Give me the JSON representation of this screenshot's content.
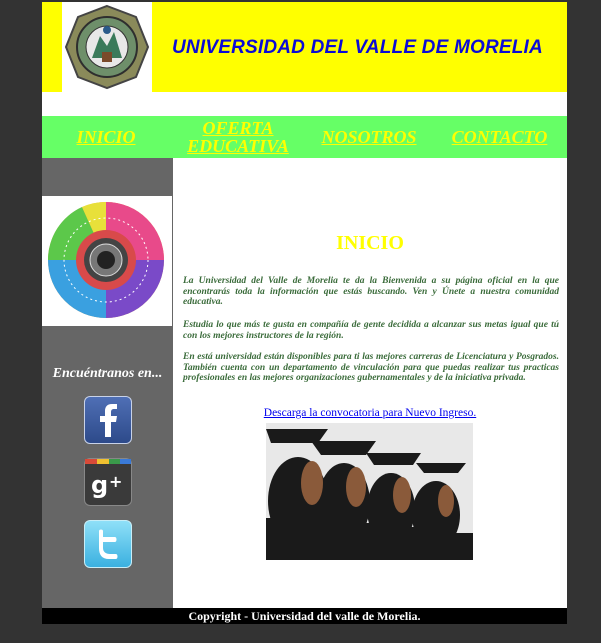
{
  "header": {
    "title": "UNIVERSIDAD DEL VALLE DE MORELIA"
  },
  "nav": {
    "items": [
      {
        "label": "INICIO"
      },
      {
        "label": "OFERTA EDUCATIVA"
      },
      {
        "label": "NOSOTROS"
      },
      {
        "label": "CONTACTO"
      }
    ]
  },
  "sidebar": {
    "find_us": "Encuéntranos en...",
    "social": [
      {
        "icon": "facebook-icon"
      },
      {
        "icon": "google-plus-icon"
      },
      {
        "icon": "twitter-icon"
      }
    ]
  },
  "content": {
    "title": "INICIO",
    "paragraphs": [
      "La Universidad del Valle de Morelia te da la Bienvenida a su página oficial en la que encontrarás toda la información que estás buscando. Ven y Únete a nuestra comunidad educativa.",
      "Estudia lo que más te gusta en compañía de gente decidida a alcanzar sus metas igual que tú con los mejores instructores de la región.",
      "En está universidad están disponibles para ti las mejores carreras de Licenciatura y Posgrados. También cuenta con un departamento de vinculación para que puedas realizar tus practicas profesionales en las mejores organizaciones gubernamentales y de la iniciativa privada."
    ],
    "download_link": "Descarga la convocatoria para Nuevo Ingreso."
  },
  "footer": {
    "copyright": "Copyright - Universidad del valle de Morelia."
  },
  "colors": {
    "background": "#333333",
    "header": "#ffff00",
    "nav": "#66ff66",
    "nav_text": "#ffff00",
    "sidebar": "#666666",
    "title_text": "#0b0bd6",
    "footer": "#000000"
  }
}
